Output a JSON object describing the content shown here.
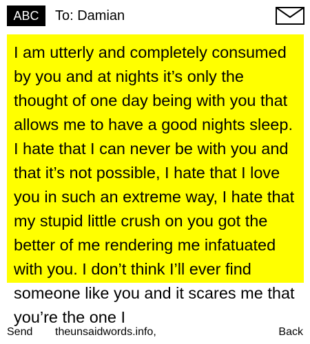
{
  "header": {
    "mode_label": "ABC",
    "recipient": "To: Damian",
    "envelope_icon": "envelope-icon"
  },
  "message": {
    "background_color": "#ffff00",
    "text": "I am utterly and completely consumed by you and at nights it’s only the thought of one day being with you that allows me to have a good nights sleep. I hate that I can never be with you and that it’s not possible, I hate that I love you in such an extreme way, I hate that my stupid little crush on you got the better of me rendering me infatuated with you. I don’t think I’ll ever find someone like you and it scares me that you’re the one I"
  },
  "footer": {
    "left_softkey": "Send",
    "caption": "theunsaidwords.info,",
    "right_softkey": "Back"
  }
}
